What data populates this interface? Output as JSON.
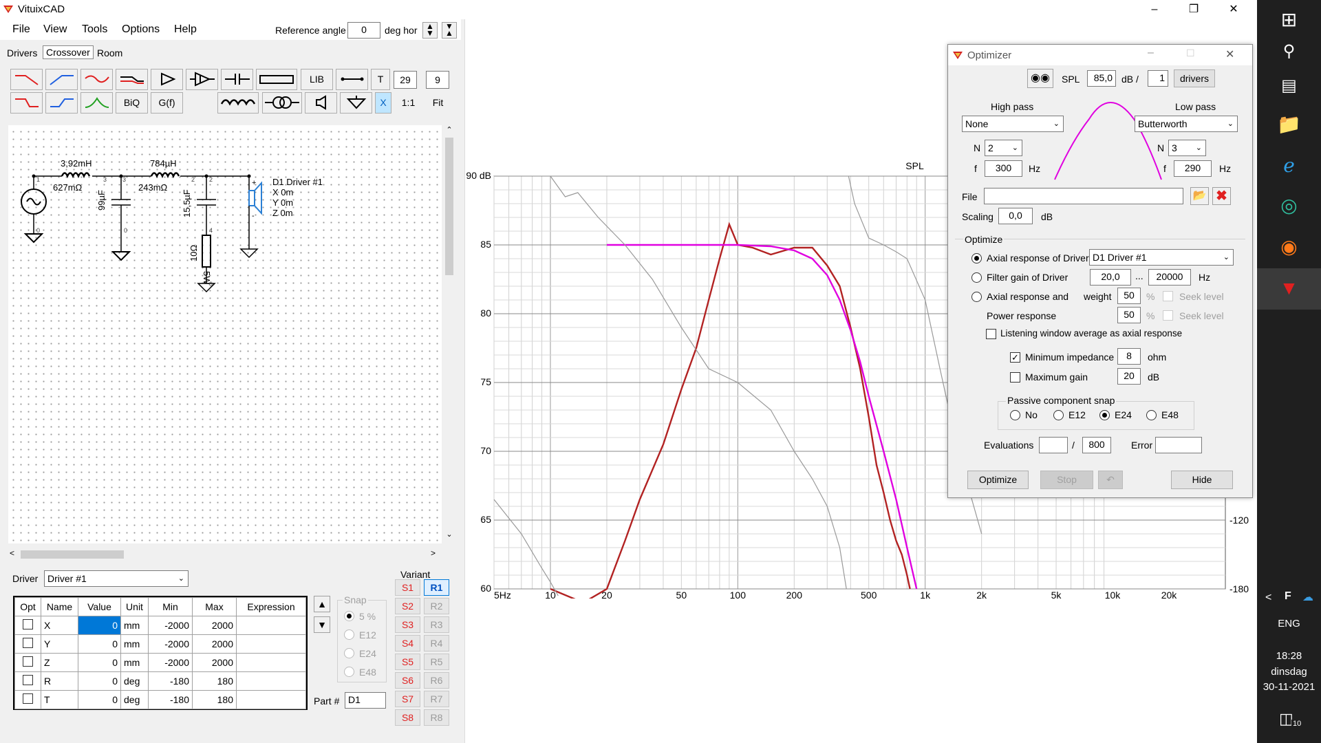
{
  "app": {
    "title": "VituixCAD"
  },
  "menu": [
    "File",
    "View",
    "Tools",
    "Options",
    "Help"
  ],
  "reference": {
    "label": "Reference angle",
    "value": "0",
    "unit": "deg hor"
  },
  "tabs": [
    "Drivers",
    "Crossover",
    "Room"
  ],
  "active_tab": "Crossover",
  "toolbar": {
    "row1_text": [
      "LIB",
      "T",
      "29",
      "9"
    ],
    "row2_text": [
      "BiQ",
      "G(f)",
      "X",
      "1:1",
      "Fit"
    ]
  },
  "schematic": {
    "l1": {
      "value": "3,92mH",
      "res": "627mΩ"
    },
    "l2": {
      "value": "784µH",
      "res": "243mΩ"
    },
    "c1": "99µF",
    "c2": "15,5µF",
    "r1": {
      "value": "10Ω",
      "power": "5W"
    },
    "driver": {
      "name": "D1 Driver #1",
      "x": "X 0m",
      "y": "Y 0m",
      "z": "Z 0m"
    },
    "node_labels": [
      "1",
      "3",
      "3",
      "2",
      "2",
      "0",
      "0",
      "4",
      "0",
      "+",
      "-"
    ]
  },
  "driver_select": {
    "label": "Driver",
    "value": "Driver #1"
  },
  "param_table": {
    "headers": [
      "Opt",
      "Name",
      "Value",
      "Unit",
      "Min",
      "Max",
      "Expression"
    ],
    "rows": [
      {
        "name": "X",
        "value": "0",
        "unit": "mm",
        "min": "-2000",
        "max": "2000"
      },
      {
        "name": "Y",
        "value": "0",
        "unit": "mm",
        "min": "-2000",
        "max": "2000"
      },
      {
        "name": "Z",
        "value": "0",
        "unit": "mm",
        "min": "-2000",
        "max": "2000"
      },
      {
        "name": "R",
        "value": "0",
        "unit": "deg",
        "min": "-180",
        "max": "180"
      },
      {
        "name": "T",
        "value": "0",
        "unit": "deg",
        "min": "-180",
        "max": "180"
      }
    ]
  },
  "snap": {
    "label": "Snap",
    "options": [
      "5 %",
      "E12",
      "E24",
      "E48"
    ]
  },
  "part": {
    "label": "Part #",
    "value": "D1"
  },
  "variant": {
    "label": "Variant",
    "s": [
      "S1",
      "S2",
      "S3",
      "S4",
      "S5",
      "S6",
      "S7",
      "S8"
    ],
    "r": [
      "R1",
      "R2",
      "R3",
      "R4",
      "R5",
      "R6",
      "R7",
      "R8"
    ]
  },
  "chart_data": {
    "type": "line",
    "title": "SPL",
    "x_scale": "log",
    "xlim": [
      5,
      40000
    ],
    "x_ticks": [
      "5Hz",
      "10",
      "20",
      "50",
      "100",
      "200",
      "500",
      "1k",
      "2k",
      "5k",
      "10k",
      "20k"
    ],
    "x_tick_values": [
      5,
      10,
      20,
      50,
      100,
      200,
      500,
      1000,
      2000,
      5000,
      10000,
      20000
    ],
    "ylim": [
      60,
      90
    ],
    "y_ticks": [
      "90 dB",
      "85",
      "80",
      "75",
      "70",
      "65",
      "60"
    ],
    "y_tick_values": [
      90,
      85,
      80,
      75,
      70,
      65,
      60
    ],
    "y2_ticks": [
      "-120",
      "-180"
    ],
    "series": [
      {
        "color": "#b22222",
        "x": [
          10,
          15,
          20,
          25,
          30,
          40,
          50,
          60,
          70,
          80,
          90,
          100,
          120,
          150,
          200,
          250,
          300,
          350,
          400,
          450,
          500,
          550,
          600,
          650,
          700,
          750,
          800,
          830
        ],
        "y": [
          60,
          59,
          60,
          63.5,
          66.5,
          70.5,
          74.5,
          77.5,
          81,
          84,
          86.5,
          85,
          84.8,
          84.3,
          84.8,
          84.8,
          83.5,
          82,
          79,
          76,
          72.5,
          69,
          67,
          65,
          63.5,
          62.5,
          61,
          60
        ]
      },
      {
        "color": "#e000e0",
        "x": [
          20,
          50,
          100,
          150,
          200,
          250,
          300,
          350,
          400,
          450,
          500,
          600,
          700,
          800,
          900
        ],
        "y": [
          85,
          85,
          85,
          84.9,
          84.6,
          84,
          82.8,
          81,
          78.8,
          76.5,
          74,
          70,
          66.5,
          63,
          60
        ]
      },
      {
        "color": "#999999",
        "x": [
          10,
          12,
          14,
          18,
          25,
          35,
          50,
          70,
          100,
          150,
          200,
          250,
          300,
          350,
          380
        ],
        "y": [
          90,
          88.5,
          88.8,
          87,
          85,
          82.5,
          79,
          76,
          75,
          73,
          70,
          68,
          66,
          63,
          60
        ]
      },
      {
        "color": "#999999",
        "x": [
          5,
          7,
          9,
          10,
          11
        ],
        "y": [
          66.5,
          64,
          61.5,
          60.5,
          59.5
        ]
      },
      {
        "color": "#999999",
        "x": [
          390,
          420,
          500,
          600,
          700,
          800,
          1000,
          1200,
          1500,
          2000
        ],
        "y": [
          90,
          88,
          85.5,
          85,
          84.5,
          84,
          81,
          76,
          70,
          64
        ]
      }
    ]
  },
  "optimizer": {
    "title": "Optimizer",
    "spl_label": "SPL",
    "spl_value": "85,0",
    "db_label": "dB /",
    "drivers_value": "1",
    "drivers_btn": "drivers",
    "highpass": {
      "label": "High pass",
      "type": "None",
      "n_label": "N",
      "n": "2",
      "f_label": "f",
      "f": "300",
      "unit": "Hz"
    },
    "lowpass": {
      "label": "Low pass",
      "type": "Butterworth",
      "n_label": "N",
      "n": "3",
      "f_label": "f",
      "f": "290",
      "unit": "Hz"
    },
    "file_label": "File",
    "file_value": "",
    "scaling_label": "Scaling",
    "scaling_value": "0,0",
    "scaling_unit": "dB",
    "optimize_label": "Optimize",
    "axial_driver_label": "Axial response of Driver",
    "axial_driver_value": "D1 Driver #1",
    "filter_gain_label": "Filter gain of Driver",
    "fg_from": "20,0",
    "fg_sep": "...",
    "fg_to": "20000",
    "fg_unit": "Hz",
    "axial_and_label": "Axial response and",
    "weight_label": "weight",
    "weight_axial": "50",
    "pct": "%",
    "seek_label": "Seek level",
    "power_label": "Power response",
    "weight_power": "50",
    "listening_label": "Listening window average as axial response",
    "min_imp_label": "Minimum impedance",
    "min_imp_value": "8",
    "min_imp_unit": "ohm",
    "max_gain_label": "Maximum gain",
    "max_gain_value": "20",
    "max_gain_unit": "dB",
    "snap_label": "Passive component snap",
    "snap_options": [
      "No",
      "E12",
      "E24",
      "E48"
    ],
    "snap_selected": "E24",
    "eval_label": "Evaluations",
    "eval_value": "",
    "eval_sep": "/",
    "eval_max": "800",
    "error_label": "Error",
    "error_value": "",
    "btn_optimize": "Optimize",
    "btn_stop": "Stop",
    "btn_hide": "Hide"
  },
  "taskbar": {
    "lang": "ENG",
    "time": "18:28",
    "day": "dinsdag",
    "date": "30-11-2021",
    "notif": "10"
  }
}
